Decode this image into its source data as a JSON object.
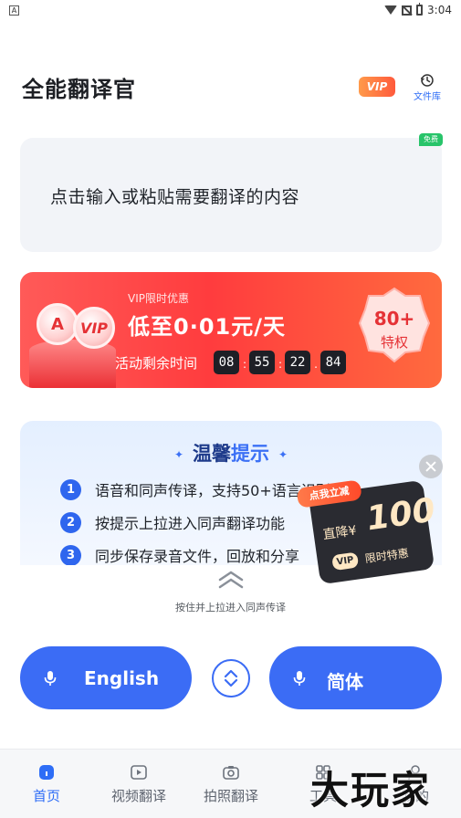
{
  "status_bar": {
    "time": "3:04",
    "app_icon_letter": "A"
  },
  "header": {
    "title": "全能翻译官",
    "vip_label": "VIP",
    "library_label": "文件库"
  },
  "input_card": {
    "placeholder": "点击输入或粘贴需要翻译的内容",
    "free_tag": "免费"
  },
  "vip_banner": {
    "coin_left": "A",
    "coin_right": "VIP",
    "subtitle": "VIP限时优惠",
    "headline": "低至0·01元/天",
    "countdown_label": "活动剩余时间",
    "countdown": [
      "08",
      "55",
      "22",
      "84"
    ],
    "separators": [
      ":",
      ":",
      "."
    ],
    "badge_line1": "80+",
    "badge_line2": "特权",
    "colors": {
      "start": "#ff5a58",
      "end": "#ff6a3e"
    }
  },
  "tips": {
    "title_part1": "温馨",
    "title_part2": "提示",
    "items": [
      {
        "num": "1",
        "text": "语音和同声传译，支持50+语言识别翻译"
      },
      {
        "num": "2",
        "text": "按提示上拉进入同声翻译功能"
      },
      {
        "num": "3",
        "text": "同步保存录音文件，回放和分享"
      }
    ]
  },
  "coupon": {
    "tag": "点我立减",
    "label": "直降¥",
    "amount": "100",
    "vip": "VIP",
    "limited": "限时特惠"
  },
  "pull_hint": "按住并上拉进入同声传译",
  "languages": {
    "source": "English",
    "target": "简体"
  },
  "tabs": [
    {
      "label": "首页",
      "icon": "home-icon",
      "active": true
    },
    {
      "label": "视频翻译",
      "icon": "video-icon",
      "active": false
    },
    {
      "label": "拍照翻译",
      "icon": "camera-icon",
      "active": false
    },
    {
      "label": "工具",
      "icon": "tools-icon",
      "active": false
    },
    {
      "label": "我的",
      "icon": "profile-icon",
      "active": false
    }
  ],
  "watermark": "大玩家",
  "colors": {
    "accent": "#3b6cf5",
    "free_green": "#28c46a",
    "nav_active": "#2e6df6"
  }
}
